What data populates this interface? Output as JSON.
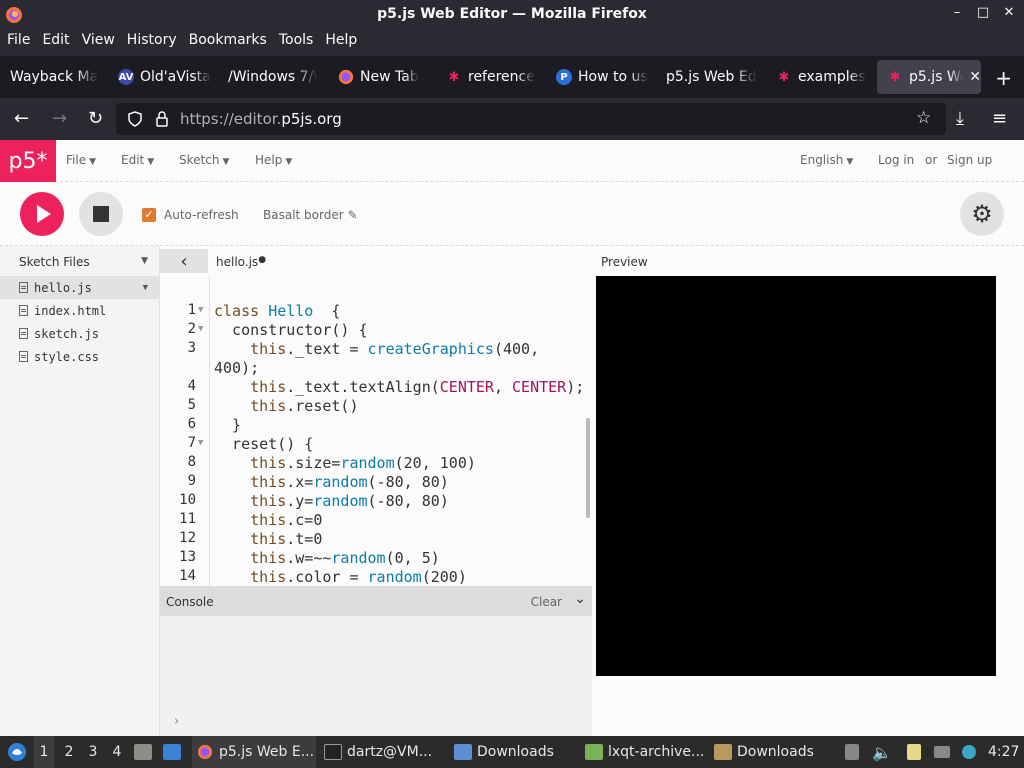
{
  "window": {
    "title": "p5.js Web Editor — Mozilla Firefox",
    "controls": [
      "–",
      "□",
      "✕"
    ]
  },
  "menubar": [
    "File",
    "Edit",
    "View",
    "History",
    "Bookmarks",
    "Tools",
    "Help"
  ],
  "tabs": [
    {
      "label": "Wayback Ma",
      "icon": "",
      "active": false
    },
    {
      "label": "Old'aVista",
      "icon": "AV",
      "active": false
    },
    {
      "label": "/Windows 7/\\",
      "icon": "",
      "active": false
    },
    {
      "label": "New Tab",
      "icon": "firefox-icon",
      "active": false
    },
    {
      "label": "reference",
      "icon": "p5-star-icon",
      "active": false
    },
    {
      "label": "How to us",
      "icon": "P",
      "active": false
    },
    {
      "label": "p5.js Web Ed",
      "icon": "",
      "active": false
    },
    {
      "label": "examples",
      "icon": "p5-star-icon",
      "active": false
    },
    {
      "label": "p5.js We",
      "icon": "p5-star-icon",
      "active": true,
      "close": "✕"
    }
  ],
  "newtab_label": "+",
  "urlbar": {
    "prefix": "https://editor.",
    "domain": "p5js.org"
  },
  "p5": {
    "logo": "p5*",
    "nav": [
      "File",
      "Edit",
      "Sketch",
      "Help"
    ],
    "language": "English",
    "login": "Log in",
    "or": "or",
    "signup": "Sign up",
    "autorefresh_label": "Auto-refresh",
    "autorefresh_checked": true,
    "sketch_name": "Basalt border ✎",
    "sidebar_title": "Sketch Files",
    "files": [
      "hello.js",
      "index.html",
      "sketch.js",
      "style.css"
    ],
    "selected_file": "hello.js",
    "editor_filename": "hello.js",
    "console_label": "Console",
    "console_clear": "Clear",
    "preview_label": "Preview",
    "accent": "#ed225d"
  },
  "code_lines": [
    {
      "n": "1",
      "fold": true,
      "tokens": [
        [
          "kw",
          "class "
        ],
        [
          "cls",
          "Hello"
        ],
        [
          "",
          "  {"
        ]
      ]
    },
    {
      "n": "2",
      "fold": true,
      "tokens": [
        [
          "",
          "  constructor() {"
        ]
      ]
    },
    {
      "n": "3",
      "fold": false,
      "tokens": [
        [
          "th",
          "    this"
        ],
        [
          "",
          "._text = "
        ],
        [
          "fn",
          "createGraphics"
        ],
        [
          "",
          "(400,"
        ]
      ]
    },
    {
      "n": "",
      "fold": false,
      "tokens": [
        [
          "",
          "400);"
        ]
      ]
    },
    {
      "n": "4",
      "fold": false,
      "tokens": [
        [
          "th",
          "    this"
        ],
        [
          "",
          "._text.textAlign("
        ],
        [
          "cn",
          "CENTER"
        ],
        [
          "",
          ", "
        ],
        [
          "cn",
          "CENTER"
        ],
        [
          "",
          ");"
        ]
      ]
    },
    {
      "n": "5",
      "fold": false,
      "tokens": [
        [
          "th",
          "    this"
        ],
        [
          "",
          ".reset()"
        ]
      ]
    },
    {
      "n": "6",
      "fold": false,
      "tokens": [
        [
          "",
          "  }"
        ]
      ]
    },
    {
      "n": "7",
      "fold": true,
      "tokens": [
        [
          "",
          "  reset() {"
        ]
      ]
    },
    {
      "n": "8",
      "fold": false,
      "tokens": [
        [
          "th",
          "    this"
        ],
        [
          "",
          ".size="
        ],
        [
          "fn",
          "random"
        ],
        [
          "",
          "(20, 100)"
        ]
      ]
    },
    {
      "n": "9",
      "fold": false,
      "tokens": [
        [
          "th",
          "    this"
        ],
        [
          "",
          ".x="
        ],
        [
          "fn",
          "random"
        ],
        [
          "",
          "(-80, 80)"
        ]
      ]
    },
    {
      "n": "10",
      "fold": false,
      "tokens": [
        [
          "th",
          "    this"
        ],
        [
          "",
          ".y="
        ],
        [
          "fn",
          "random"
        ],
        [
          "",
          "(-80, 80)"
        ]
      ]
    },
    {
      "n": "11",
      "fold": false,
      "tokens": [
        [
          "th",
          "    this"
        ],
        [
          "",
          ".c=0"
        ]
      ]
    },
    {
      "n": "12",
      "fold": false,
      "tokens": [
        [
          "th",
          "    this"
        ],
        [
          "",
          ".t=0"
        ]
      ]
    },
    {
      "n": "13",
      "fold": false,
      "tokens": [
        [
          "th",
          "    this"
        ],
        [
          "",
          ".w=~~"
        ],
        [
          "fn",
          "random"
        ],
        [
          "",
          "(0, 5)"
        ]
      ]
    },
    {
      "n": "14",
      "fold": false,
      "tokens": [
        [
          "th",
          "    this"
        ],
        [
          "",
          ".color = "
        ],
        [
          "fn",
          "random"
        ],
        [
          "",
          "(200)"
        ]
      ]
    }
  ],
  "taskbar": {
    "workspaces": [
      "1",
      "2",
      "3",
      "4"
    ],
    "items": [
      {
        "label": "p5.js Web E...",
        "icon": "firefox-icon"
      },
      {
        "label": "dartz@VM...",
        "icon": "terminal-icon"
      },
      {
        "label": "Downloads",
        "icon": "folder-icon"
      },
      {
        "label": "lxqt-archive...",
        "icon": "archive-icon"
      },
      {
        "label": "Downloads",
        "icon": "folder-icon"
      }
    ],
    "clock": "4:27"
  }
}
